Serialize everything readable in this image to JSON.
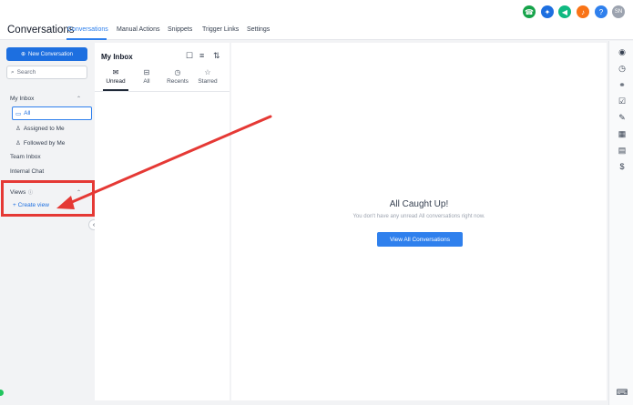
{
  "header": {
    "app_title": "Conversations",
    "tabs": [
      {
        "label": "Conversations"
      },
      {
        "label": "Manual Actions"
      },
      {
        "label": "Snippets"
      },
      {
        "label": "Trigger Links"
      },
      {
        "label": "Settings"
      }
    ],
    "active_tab": "Conversations",
    "icons": [
      {
        "name": "phone-icon",
        "color": "#16a34a"
      },
      {
        "name": "magic-icon",
        "color": "#1d6fe0"
      },
      {
        "name": "megaphone-icon",
        "color": "#10b981"
      },
      {
        "name": "bell-icon",
        "color": "#f97316"
      },
      {
        "name": "help-icon",
        "color": "#2f80ed"
      }
    ],
    "avatar_initials": "SN"
  },
  "sidebar": {
    "new_conversation_label": "New Conversation",
    "search_placeholder": "Search",
    "my_inbox_label": "My Inbox",
    "items": [
      {
        "label": "All"
      },
      {
        "label": "Assigned to Me"
      },
      {
        "label": "Followed by Me"
      }
    ],
    "team_inbox_label": "Team Inbox",
    "internal_chat_label": "Internal Chat",
    "views_label": "Views",
    "create_view_label": "Create view"
  },
  "inbox": {
    "title": "My Inbox",
    "tabs": [
      {
        "label": "Unread"
      },
      {
        "label": "All"
      },
      {
        "label": "Recents"
      },
      {
        "label": "Starred"
      }
    ],
    "active_tab": "Unread"
  },
  "main": {
    "empty_title": "All Caught Up!",
    "empty_subtitle": "You don't have any unread All conversations right now.",
    "view_all_label": "View All Conversations"
  },
  "colors": {
    "accent": "#2f80ed",
    "primary_button": "#1d6fe0",
    "annotation": "#e53935"
  }
}
